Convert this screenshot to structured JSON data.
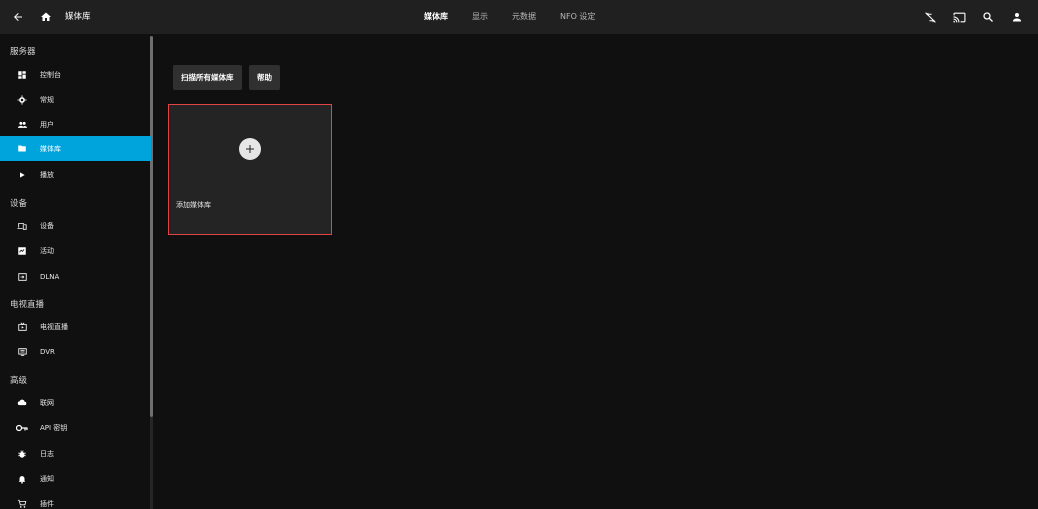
{
  "header": {
    "title": "媒体库",
    "tabs": [
      {
        "label": "媒体库",
        "active": true
      },
      {
        "label": "显示",
        "active": false
      },
      {
        "label": "元数据",
        "active": false
      },
      {
        "label": "NFO 设定",
        "active": false
      }
    ],
    "icons": [
      "sync-icon",
      "cast-icon",
      "search-icon",
      "user-icon"
    ]
  },
  "sidebar": {
    "sections": [
      {
        "title": "服务器",
        "items": [
          {
            "label": "控制台",
            "icon": "dashboard-icon",
            "active": false
          },
          {
            "label": "常规",
            "icon": "gear-icon",
            "active": false
          },
          {
            "label": "用户",
            "icon": "users-icon",
            "active": false
          },
          {
            "label": "媒体库",
            "icon": "folder-icon",
            "active": true
          },
          {
            "label": "播放",
            "icon": "play-icon",
            "active": false
          }
        ]
      },
      {
        "title": "设备",
        "items": [
          {
            "label": "设备",
            "icon": "devices-icon",
            "active": false
          },
          {
            "label": "活动",
            "icon": "activity-icon",
            "active": false
          },
          {
            "label": "DLNA",
            "icon": "input-icon",
            "active": false
          }
        ]
      },
      {
        "title": "电视直播",
        "items": [
          {
            "label": "电视直播",
            "icon": "live-tv-icon",
            "active": false
          },
          {
            "label": "DVR",
            "icon": "dvr-icon",
            "active": false
          }
        ]
      },
      {
        "title": "高级",
        "items": [
          {
            "label": "联网",
            "icon": "cloud-icon",
            "active": false
          },
          {
            "label": "API 密钥",
            "icon": "key-icon",
            "active": false
          },
          {
            "label": "日志",
            "icon": "bug-icon",
            "active": false
          },
          {
            "label": "通知",
            "icon": "bell-icon",
            "active": false
          },
          {
            "label": "插件",
            "icon": "cart-icon",
            "active": false
          }
        ]
      }
    ]
  },
  "main": {
    "scan_button": "扫描所有媒体库",
    "help_button": "帮助",
    "add_library_label": "添加媒体库"
  },
  "colors": {
    "accent": "#00a4dc",
    "card_border": "#e04444",
    "header_bg": "#202020",
    "body_bg": "#101010"
  }
}
